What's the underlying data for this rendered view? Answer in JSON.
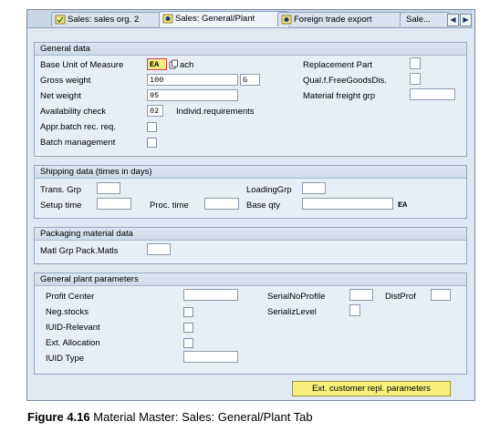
{
  "tabs": [
    {
      "label": "Sales: sales org. 2"
    },
    {
      "label": "Sales: General/Plant"
    },
    {
      "label": "Foreign trade export"
    },
    {
      "label": "Sale..."
    }
  ],
  "general_data": {
    "title": "General data",
    "base_uom_label": "Base Unit of Measure",
    "base_uom_value": "EA",
    "base_uom_text": "ach",
    "gross_weight_label": "Gross weight",
    "gross_weight_value": "100",
    "weight_unit": "G",
    "net_weight_label": "Net weight",
    "net_weight_value": "95",
    "availability_check_label": "Availability check",
    "availability_check_value": "02",
    "availability_check_text": "Individ.requirements",
    "appr_batch_label": "Appr.batch rec. req.",
    "batch_mgmt_label": "Batch management",
    "replacement_part_label": "Replacement Part",
    "qual_free_goods_label": "Qual.f.FreeGoodsDis.",
    "material_freight_label": "Material freight grp"
  },
  "shipping_data": {
    "title": "Shipping data (times in days)",
    "trans_grp_label": "Trans. Grp",
    "loading_grp_label": "LoadingGrp",
    "setup_time_label": "Setup time",
    "proc_time_label": "Proc. time",
    "base_qty_label": "Base qty",
    "base_qty_unit": "EA"
  },
  "packaging_data": {
    "title": "Packaging material data",
    "matl_grp_label": "Matl Grp Pack.Matls"
  },
  "plant_params": {
    "title": "General plant parameters",
    "profit_center_label": "Profit Center",
    "serial_no_profile_label": "SerialNoProfile",
    "dist_prof_label": "DistProf",
    "neg_stocks_label": "Neg.stocks",
    "serializ_level_label": "SerializLevel",
    "iuid_relevant_label": "IUID-Relevant",
    "ext_allocation_label": "Ext. Allocation",
    "iuid_type_label": "IUID Type"
  },
  "ext_button_label": "Ext. customer repl. parameters",
  "caption": {
    "figure": "Figure 4.16",
    "text": "Material Master: Sales: General/Plant Tab"
  },
  "colors": {
    "frame_bg": "#dfe8f3",
    "group_bg": "#e8eef6",
    "highlight_field": "#f5ec7a",
    "button_bg": "#f7ef7a"
  }
}
